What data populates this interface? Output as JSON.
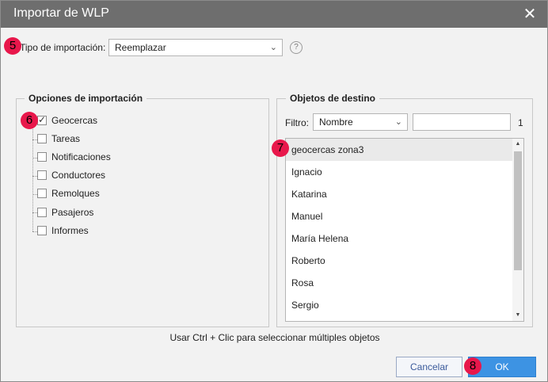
{
  "dialog": {
    "title": "Importar de WLP",
    "close_glyph": "✕"
  },
  "import_type": {
    "label": "Tipo de importación:",
    "value": "Reemplazar",
    "help": "?"
  },
  "options": {
    "legend": "Opciones de importación",
    "items": [
      {
        "label": "Geocercas",
        "checked": true
      },
      {
        "label": "Tareas",
        "checked": false
      },
      {
        "label": "Notificaciones",
        "checked": false
      },
      {
        "label": "Conductores",
        "checked": false
      },
      {
        "label": "Remolques",
        "checked": false
      },
      {
        "label": "Pasajeros",
        "checked": false
      },
      {
        "label": "Informes",
        "checked": false
      }
    ]
  },
  "targets": {
    "legend": "Objetos de destino",
    "filter_label": "Filtro:",
    "filter_field": "Nombre",
    "filter_value": "",
    "count": "1",
    "items": [
      "geocercas zona3",
      "Ignacio",
      "Katarina",
      "Manuel",
      "María Helena",
      "Roberto",
      "Rosa",
      "Sergio"
    ],
    "selected_index": 0
  },
  "hint": "Usar Ctrl + Clic para seleccionar múltiples objetos",
  "buttons": {
    "cancel": "Cancelar",
    "ok": "OK"
  },
  "badges": [
    "5",
    "6",
    "7",
    "8"
  ],
  "colors": {
    "titlebar": "#6e6e6e",
    "badge": "#e8174b",
    "ok_button": "#3d93e3"
  }
}
